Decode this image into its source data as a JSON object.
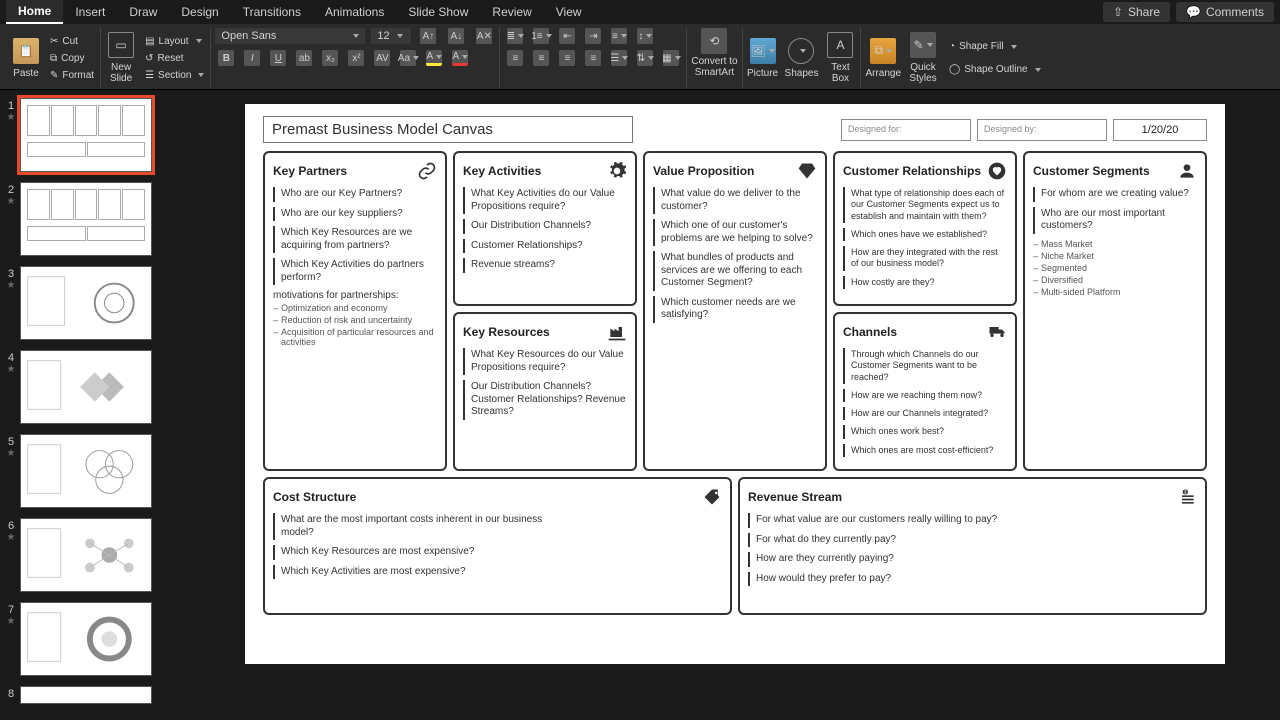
{
  "menu": {
    "tabs": [
      "Home",
      "Insert",
      "Draw",
      "Design",
      "Transitions",
      "Animations",
      "Slide Show",
      "Review",
      "View"
    ],
    "active": 0,
    "share": "Share",
    "comments": "Comments"
  },
  "ribbon": {
    "paste": "Paste",
    "cut": "Cut",
    "copy": "Copy",
    "format": "Format",
    "newslide": "New\nSlide",
    "layout": "Layout",
    "reset": "Reset",
    "section": "Section",
    "font": "Open Sans",
    "size": "12",
    "convert": "Convert to\nSmartArt",
    "picture": "Picture",
    "shapes": "Shapes",
    "textbox": "Text\nBox",
    "arrange": "Arrange",
    "quick": "Quick\nStyles",
    "shapefill": "Shape Fill",
    "shapeoutline": "Shape Outline"
  },
  "slide": {
    "title": "Premast Business Model Canvas",
    "designed_for": "Designed for:",
    "designed_by": "Designed by:",
    "date": "1/20/20",
    "cards": {
      "partners": {
        "title": "Key Partners",
        "q": [
          "Who are our Key Partners?",
          "Who are our key suppliers?",
          "Which Key Resources are we acquiring from partners?",
          "Which Key Activities do partners perform?"
        ],
        "motiv_head": "motivations for partnerships:",
        "motiv": [
          "Optimization and economy",
          "Reduction of risk and uncertainty",
          "Acquisition of particular resources and activities"
        ]
      },
      "activities": {
        "title": "Key Activities",
        "q": [
          "What Key Activities do our Value Propositions require?",
          "Our Distribution Channels?",
          "Customer Relationships?",
          "Revenue streams?"
        ]
      },
      "resources": {
        "title": "Key Resources",
        "q": [
          "What Key Resources do our Value Propositions require?",
          "Our Distribution Channels? Customer Relationships? Revenue Streams?"
        ]
      },
      "valueprop": {
        "title": "Value Proposition",
        "q": [
          "What value do we deliver to the customer?",
          "Which one of our customer's problems are we helping to solve?",
          "What bundles of products and services are we offering to each Customer Segment?",
          "Which customer needs are we satisfying?"
        ]
      },
      "relationships": {
        "title": "Customer Relationships",
        "q": [
          "What type of relationship does each of our Customer Segments expect us to establish and maintain with them?",
          "Which ones have we established?",
          "How are they integrated with the rest of our business model?",
          "How costly are they?"
        ]
      },
      "channels": {
        "title": "Channels",
        "q": [
          "Through which Channels do our Customer Segments want to be reached?",
          "How are we reaching them now?",
          "How are our Channels integrated?",
          "Which ones work best?",
          "Which ones are most cost-efficient?"
        ]
      },
      "segments": {
        "title": "Customer Segments",
        "q": [
          "For whom are we creating value?",
          "Who are our most important customers?"
        ],
        "sub": [
          "Mass Market",
          "Niche Market",
          "Segmented",
          "Diversified",
          "Multi-sided Platform"
        ]
      },
      "cost": {
        "title": "Cost Structure",
        "q": [
          "What are the most important costs inherent in our business model?",
          "Which Key Resources are most expensive?",
          "Which Key Activities are most expensive?"
        ]
      },
      "revenue": {
        "title": "Revenue Stream",
        "q": [
          "For what value are our customers really willing to pay?",
          "For what do they currently pay?",
          "How are they currently paying?",
          "How would they prefer to pay?"
        ]
      }
    }
  },
  "thumb_count": 8
}
